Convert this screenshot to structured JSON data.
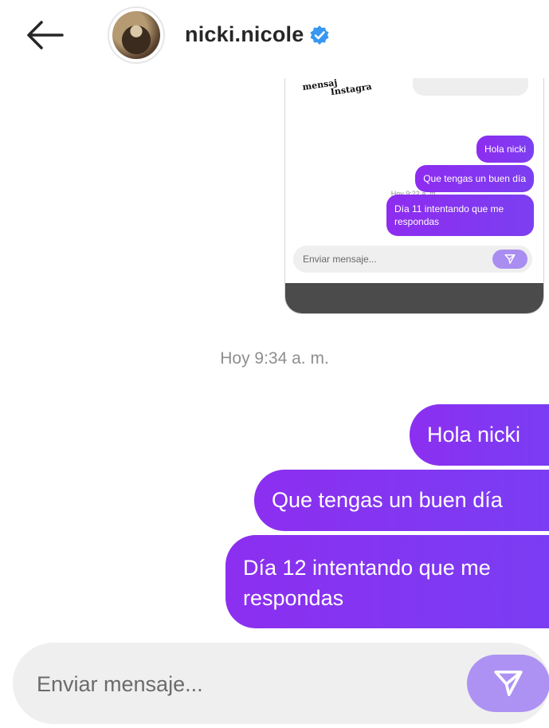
{
  "header": {
    "back_icon": "arrow-left-icon",
    "username": "nicki.nicole",
    "verified_icon": "verified-badge-icon",
    "verified_color": "#3897f0"
  },
  "embedded_screenshot": {
    "sticker_text_line1": "mensaj",
    "sticker_text_line2": "Instagra",
    "timestamp": "Hoy 9:22 a. m.",
    "messages": [
      {
        "text": "Hola nicki"
      },
      {
        "text": "Que tengas un buen día"
      },
      {
        "text": "Día 11 intentando que me respondas"
      }
    ],
    "input_placeholder": "Enviar mensaje..."
  },
  "conversation": {
    "timestamp": "Hoy 9:34 a. m.",
    "messages": [
      {
        "text": "Hola nicki"
      },
      {
        "text": "Que tengas un buen día"
      },
      {
        "text": "Día 12 intentando que me respondas"
      }
    ],
    "bubble_color": "#8a2ff0"
  },
  "composer": {
    "placeholder": "Enviar mensaje...",
    "send_icon": "send-icon",
    "send_color": "#ad92f3"
  }
}
